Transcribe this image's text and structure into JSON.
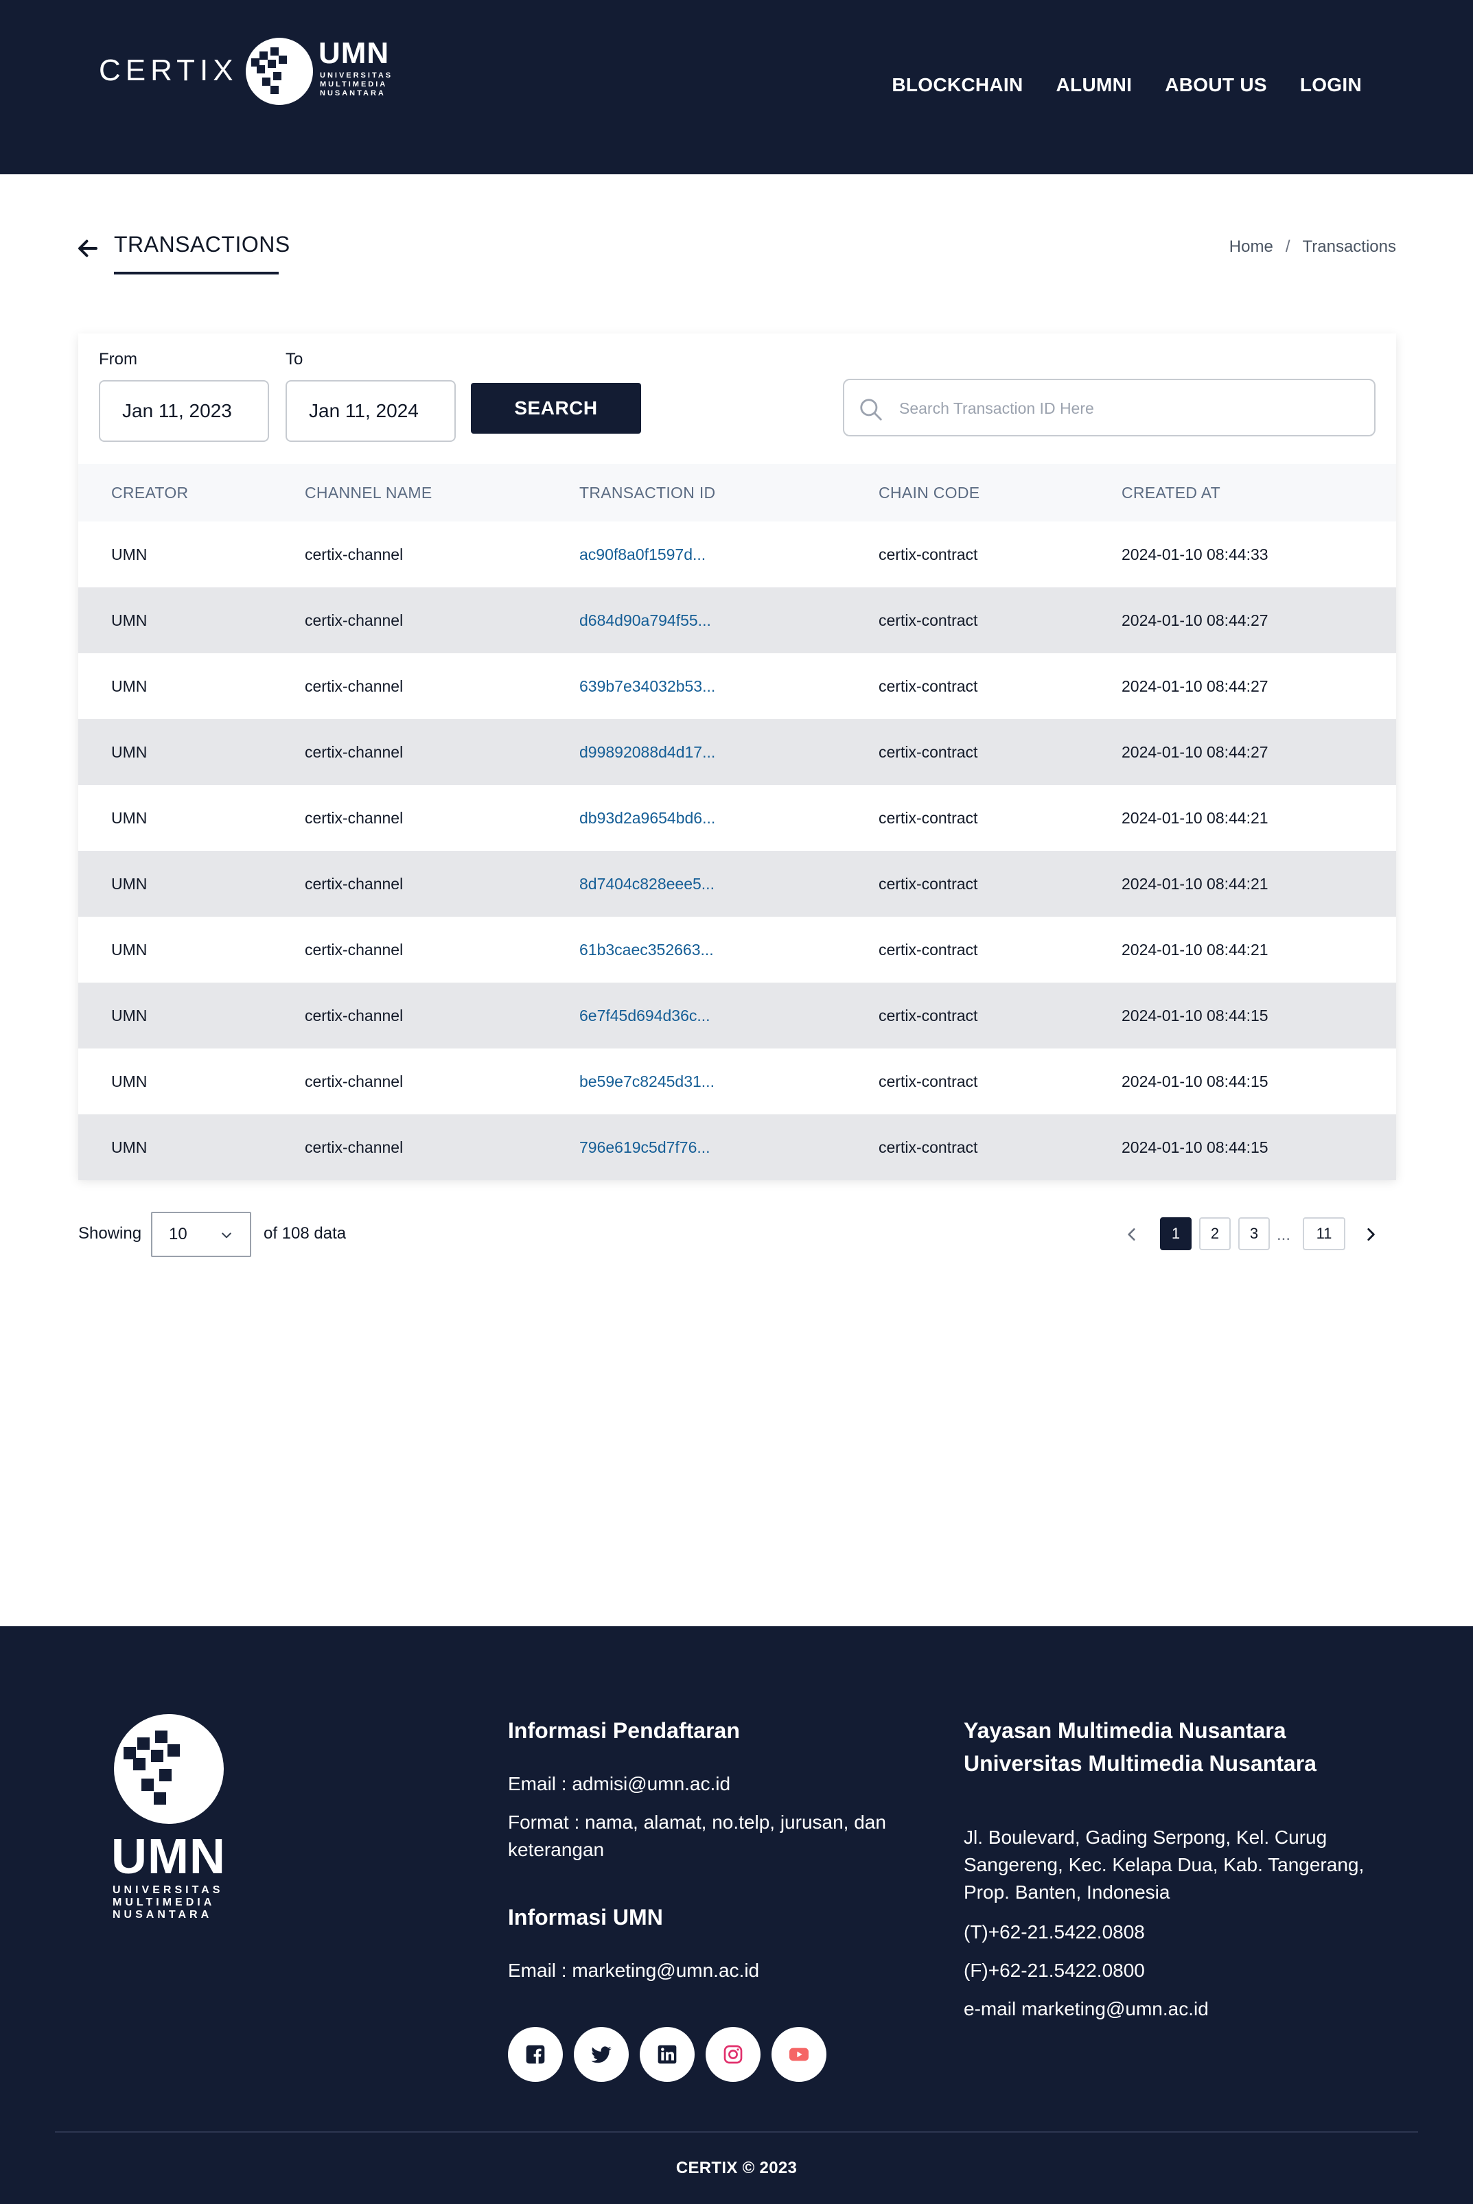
{
  "header": {
    "brand": "CERTIX",
    "logo_word": "UMN",
    "logo_sub": [
      "UNIVERSITAS",
      "MULTIMEDIA",
      "NUSANTARA"
    ],
    "nav": [
      "BLOCKCHAIN",
      "ALUMNI",
      "ABOUT US",
      "LOGIN"
    ]
  },
  "page": {
    "title": "TRANSACTIONS",
    "breadcrumb": [
      "Home",
      "/",
      "Transactions"
    ]
  },
  "filters": {
    "from_label": "From",
    "from_value": "Jan 11, 2023",
    "to_label": "To",
    "to_value": "Jan 11, 2024",
    "search_button": "SEARCH",
    "search_placeholder": "Search Transaction ID Here"
  },
  "table": {
    "columns": [
      "CREATOR",
      "CHANNEL NAME",
      "TRANSACTION ID",
      "CHAIN CODE",
      "CREATED AT"
    ],
    "rows": [
      [
        "UMN",
        "certix-channel",
        "ac90f8a0f1597d...",
        "certix-contract",
        "2024-01-10 08:44:33"
      ],
      [
        "UMN",
        "certix-channel",
        "d684d90a794f55...",
        "certix-contract",
        "2024-01-10 08:44:27"
      ],
      [
        "UMN",
        "certix-channel",
        "639b7e34032b53...",
        "certix-contract",
        "2024-01-10 08:44:27"
      ],
      [
        "UMN",
        "certix-channel",
        "d99892088d4d17...",
        "certix-contract",
        "2024-01-10 08:44:27"
      ],
      [
        "UMN",
        "certix-channel",
        "db93d2a9654bd6...",
        "certix-contract",
        "2024-01-10 08:44:21"
      ],
      [
        "UMN",
        "certix-channel",
        "8d7404c828eee5...",
        "certix-contract",
        "2024-01-10 08:44:21"
      ],
      [
        "UMN",
        "certix-channel",
        "61b3caec352663...",
        "certix-contract",
        "2024-01-10 08:44:21"
      ],
      [
        "UMN",
        "certix-channel",
        "6e7f45d694d36c...",
        "certix-contract",
        "2024-01-10 08:44:15"
      ],
      [
        "UMN",
        "certix-channel",
        "be59e7c8245d31...",
        "certix-contract",
        "2024-01-10 08:44:15"
      ],
      [
        "UMN",
        "certix-channel",
        "796e619c5d7f76...",
        "certix-contract",
        "2024-01-10 08:44:15"
      ]
    ]
  },
  "pagination": {
    "showing_label": "Showing",
    "page_size": "10",
    "of_text": "of 108 data",
    "pages": [
      "1",
      "2",
      "3",
      "11"
    ],
    "ellipsis": "...",
    "active_page": "1"
  },
  "footer": {
    "logo_word": "UMN",
    "logo_sub": [
      "UNIVERSITAS",
      "MULTIMEDIA",
      "NUSANTARA"
    ],
    "reg_heading": "Informasi Pendaftaran",
    "reg_email": "Email :  admisi@umn.ac.id",
    "reg_format": "Format : nama, alamat, no.telp, jurusan, dan keterangan",
    "umn_heading": "Informasi UMN",
    "umn_email": "Email :  marketing@umn.ac.id",
    "org_line1": "Yayasan Multimedia Nusantara",
    "org_line2": "Universitas Multimedia Nusantara",
    "address": "Jl. Boulevard, Gading Serpong, Kel. Curug Sangereng, Kec. Kelapa Dua, Kab. Tangerang, Prop. Banten, Indonesia",
    "phone": "(T)+62-21.5422.0808",
    "fax": "(F)+62-21.5422.0800",
    "email": "e-mail  marketing@umn.ac.id",
    "socials": [
      "facebook-icon",
      "twitter-icon",
      "linkedin-icon",
      "instagram-icon",
      "youtube-icon"
    ],
    "copyright": "CERTIX © 2023"
  },
  "colors": {
    "navy": "#131c33",
    "link": "#155e96",
    "row_alt": "#e6e7ea",
    "instagram": "#e1306c",
    "youtube": "#f56565"
  }
}
